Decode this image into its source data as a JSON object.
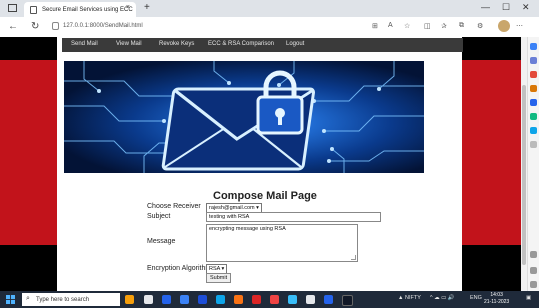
{
  "browser": {
    "tab_title": "Secure Email Services using ECC",
    "tab_close": "×",
    "new_tab": "+",
    "url": "127.0.0.1:8000/SendMail.html",
    "window_controls": {
      "minimize": "—",
      "maximize": "☐",
      "close": "✕"
    },
    "toolbar_icons": [
      "reading-icon",
      "translate-icon",
      "favorite-icon",
      "split-screen-icon",
      "favorites-icon",
      "collections-icon",
      "extensions-icon",
      "more-icon"
    ]
  },
  "nav": {
    "items": [
      "Send Mail",
      "View Mail",
      "Revoke Keys",
      "ECC & RSA Comparison",
      "Logout"
    ]
  },
  "form": {
    "title": "Compose Mail Page",
    "receiver_label": "Choose Receiver",
    "receiver_value": "rajesh@gmail.com",
    "subject_label": "Subject",
    "subject_value": "testing with RSA",
    "message_label": "Message",
    "message_value": "encrypting message using RSA",
    "algorithm_label": "Encryption Algorithm",
    "algorithm_value": "RSA",
    "submit_label": "Submit"
  },
  "taskbar": {
    "search_placeholder": "Type here to search",
    "stock_label": "NIFTY",
    "language": "ENG",
    "time": "14:03",
    "date": "21-11-2023"
  },
  "colors": {
    "menubar": "#3a3a3a",
    "page_red": "#c2131b",
    "page_black": "#000000",
    "banner_dark": "#041a4e",
    "banner_glow": "#36a8ff"
  }
}
